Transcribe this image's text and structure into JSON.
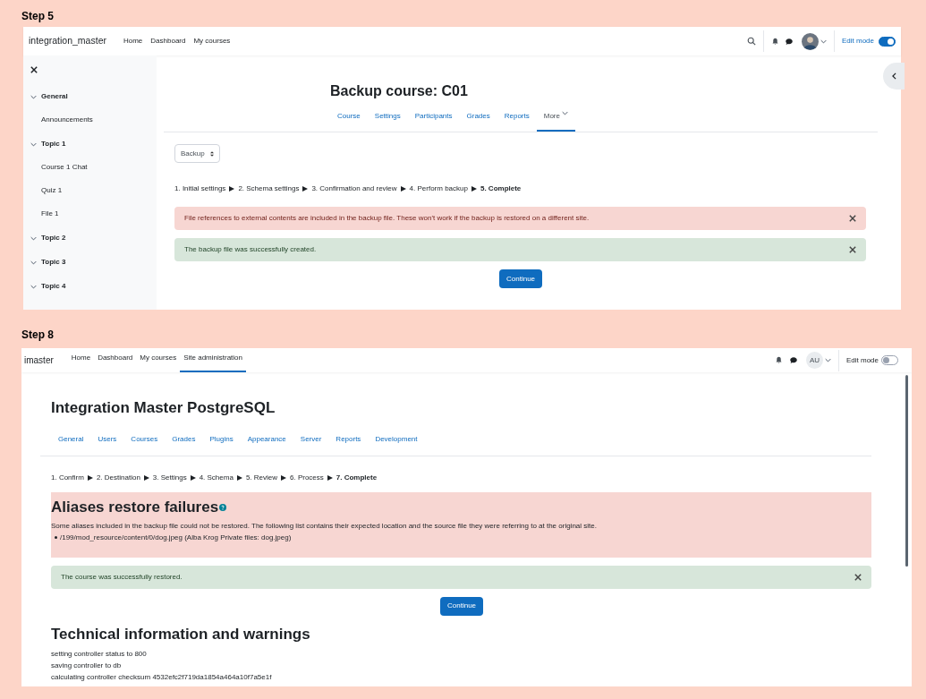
{
  "step5": {
    "label": "Step 5",
    "navbar": {
      "brand": "integration_master",
      "links": [
        {
          "label": "Home"
        },
        {
          "label": "Dashboard"
        },
        {
          "label": "My courses"
        }
      ],
      "edit_mode": {
        "label": "Edit mode",
        "on": true
      }
    },
    "sidebar": {
      "sections": [
        {
          "title": "General",
          "expanded": true,
          "children": [
            {
              "label": "Announcements"
            }
          ]
        },
        {
          "title": "Topic 1",
          "expanded": true,
          "children": [
            {
              "label": "Course 1 Chat"
            },
            {
              "label": "Quiz 1"
            },
            {
              "label": "File 1"
            }
          ]
        },
        {
          "title": "Topic 2",
          "expanded": true
        },
        {
          "title": "Topic 3",
          "expanded": true
        },
        {
          "title": "Topic 4",
          "expanded": true
        }
      ]
    },
    "heading": "Backup course: C01",
    "tabs": [
      {
        "label": "Course",
        "selected": false
      },
      {
        "label": "Settings",
        "selected": false
      },
      {
        "label": "Participants",
        "selected": false
      },
      {
        "label": "Grades",
        "selected": false
      },
      {
        "label": "Reports",
        "selected": false
      },
      {
        "label": "More",
        "selected": true
      }
    ],
    "select": {
      "value": "Backup"
    },
    "progress": [
      {
        "label": "1. Initial settings",
        "current": false
      },
      {
        "label": "2. Schema settings",
        "current": false
      },
      {
        "label": "3. Confirmation and review",
        "current": false
      },
      {
        "label": "4. Perform backup",
        "current": false
      },
      {
        "label": "5. Complete",
        "current": true
      }
    ],
    "alerts": [
      {
        "kind": "danger",
        "text": "File references to external contents are included in the backup file. These won't work if the backup is restored on a different site."
      },
      {
        "kind": "success",
        "text": "The backup file was successfully created."
      }
    ],
    "button": "Continue"
  },
  "step8": {
    "label": "Step 8",
    "navbar": {
      "brand": "imaster",
      "links": [
        {
          "label": "Home",
          "selected": false
        },
        {
          "label": "Dashboard",
          "selected": false
        },
        {
          "label": "My courses",
          "selected": false
        },
        {
          "label": "Site administration",
          "selected": true
        }
      ],
      "avatar": "AU",
      "edit_mode": {
        "label": "Edit mode",
        "on": false
      }
    },
    "heading": "Integration Master PostgreSQL",
    "tabs": [
      {
        "label": "General"
      },
      {
        "label": "Users"
      },
      {
        "label": "Courses"
      },
      {
        "label": "Grades"
      },
      {
        "label": "Plugins"
      },
      {
        "label": "Appearance"
      },
      {
        "label": "Server"
      },
      {
        "label": "Reports"
      },
      {
        "label": "Development"
      }
    ],
    "progress": [
      {
        "label": "1. Confirm",
        "current": false
      },
      {
        "label": "2. Destination",
        "current": false
      },
      {
        "label": "3. Settings",
        "current": false
      },
      {
        "label": "4. Schema",
        "current": false
      },
      {
        "label": "5. Review",
        "current": false
      },
      {
        "label": "6. Process",
        "current": false
      },
      {
        "label": "7. Complete",
        "current": true
      }
    ],
    "failures": {
      "heading": "Aliases restore failures",
      "text": "Some aliases included in the backup file could not be restored. The following list contains their expected location and the source file they were referring to at the original site.",
      "items": [
        "/199/mod_resource/content/0/dog.jpeg (Alba Krog Private files: dog.jpeg)"
      ]
    },
    "alerts": [
      {
        "kind": "success",
        "text": "The course was successfully restored."
      }
    ],
    "button": "Continue",
    "tech": {
      "heading": "Technical information and warnings",
      "lines": [
        "setting controller status to 800",
        "saving controller to db",
        "calculating controller checksum 4532efc2f719da1854a464a10f7a5e1f"
      ]
    }
  }
}
